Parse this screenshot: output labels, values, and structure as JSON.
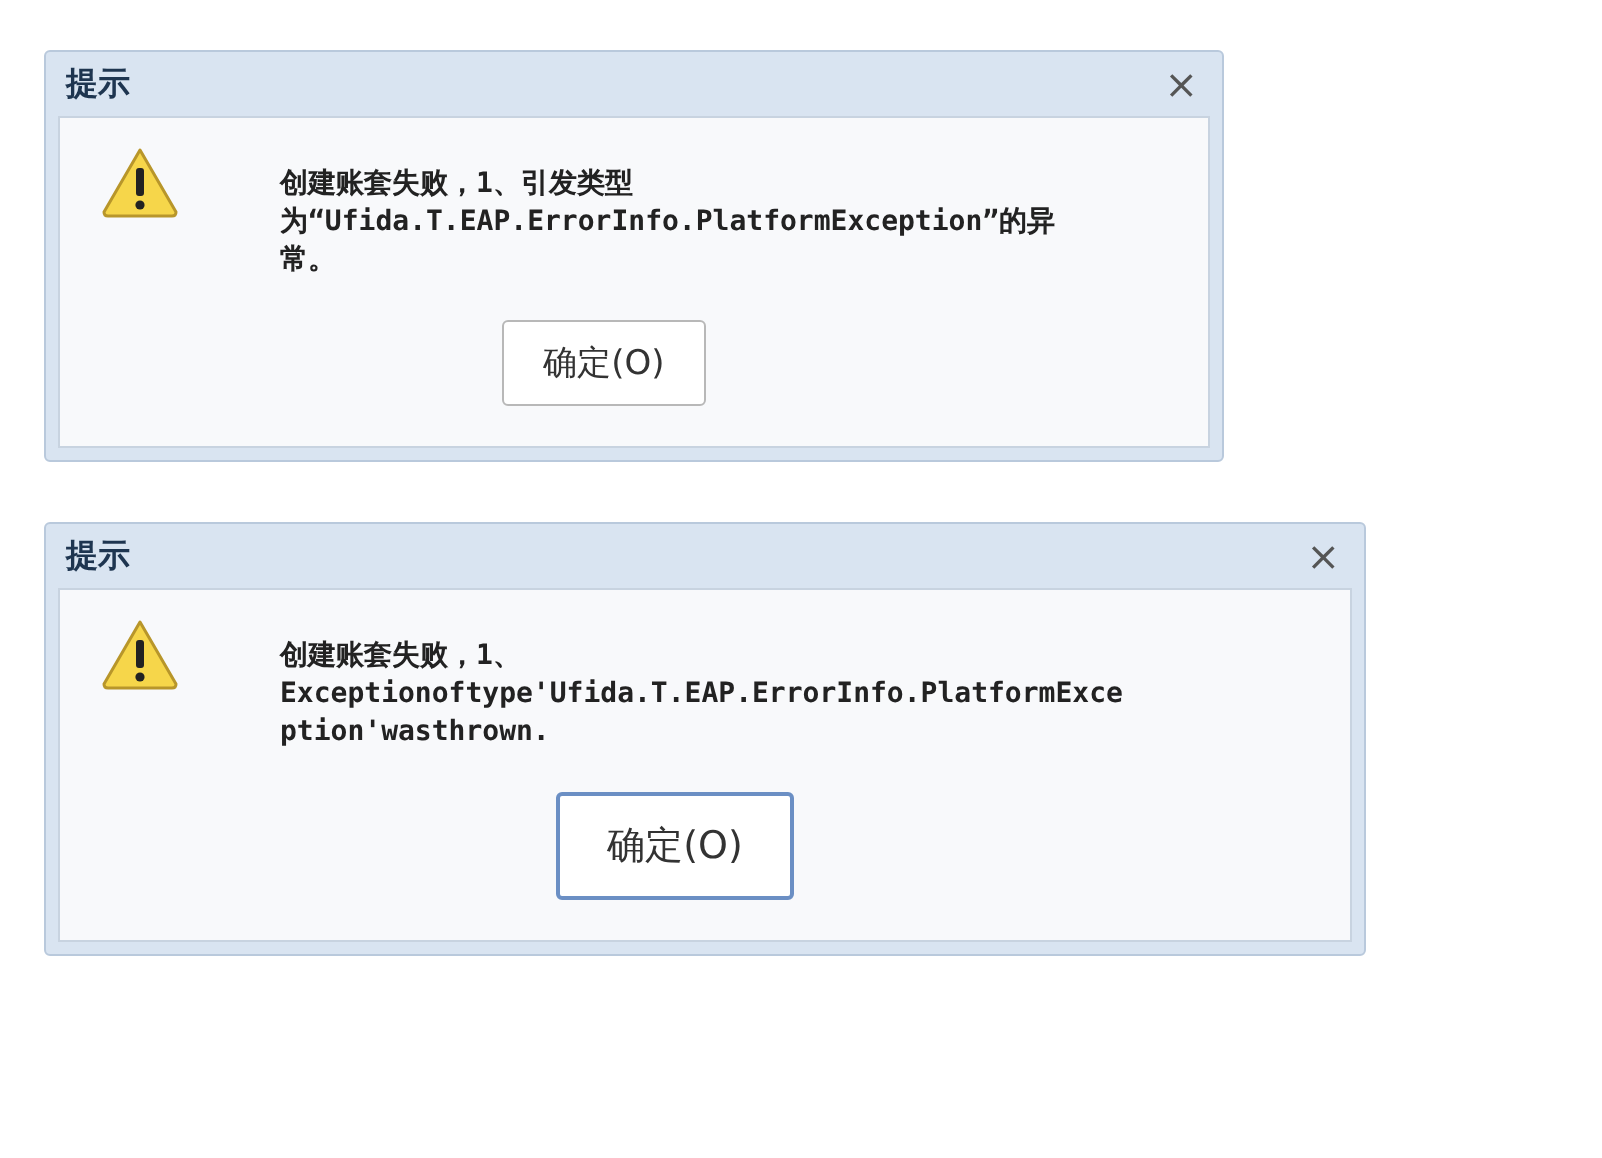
{
  "dialogs": [
    {
      "title": "提示",
      "close": "×",
      "message_lines": [
        "创建账套失败，1、引发类型",
        "为“Ufida.T.EAP.ErrorInfo.PlatformException”的异",
        "常。"
      ],
      "button": {
        "label": "确定(O)",
        "focused": false
      }
    },
    {
      "title": "提示",
      "close": "×",
      "message_lines": [
        "创建账套失败，1、",
        "Exceptionoftype'Ufida.T.EAP.ErrorInfo.PlatformExce",
        "ption'wasthrown."
      ],
      "button": {
        "label": "确定(O)",
        "focused": true
      }
    }
  ]
}
